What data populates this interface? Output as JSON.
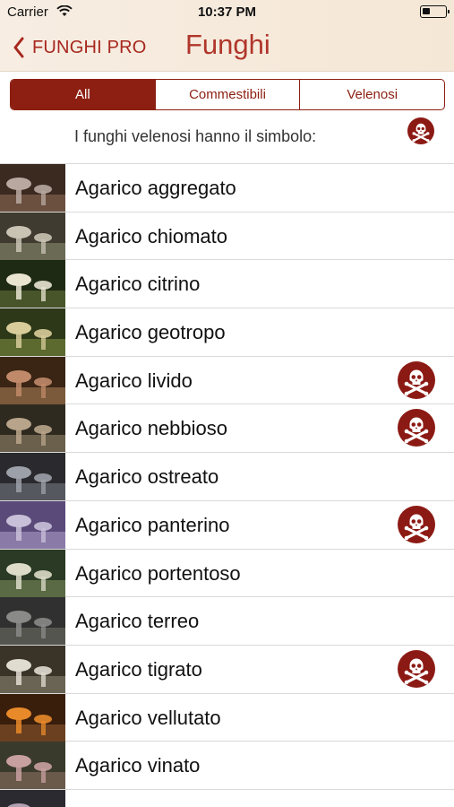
{
  "status": {
    "carrier": "Carrier",
    "time": "10:37 PM",
    "battery_level": 0.35
  },
  "nav": {
    "back_label": "FUNGHI PRO",
    "title": "Funghi"
  },
  "segments": [
    "All",
    "Commestibili",
    "Velenosi"
  ],
  "selected_segment": 0,
  "note": {
    "text": "I funghi velenosi hanno il simbolo:",
    "icon": "poison-skull-icon"
  },
  "colors": {
    "accent": "#8c1f12",
    "title": "#b0362b",
    "poison": "#8c1a14"
  },
  "items": [
    {
      "label": "Agarico aggregato",
      "poisonous": false,
      "thumb": "mushroom-photo-aggregato"
    },
    {
      "label": "Agarico chiomato",
      "poisonous": false,
      "thumb": "mushroom-photo-chiomato"
    },
    {
      "label": "Agarico citrino",
      "poisonous": false,
      "thumb": "mushroom-photo-citrino"
    },
    {
      "label": "Agarico geotropo",
      "poisonous": false,
      "thumb": "mushroom-photo-geotropo"
    },
    {
      "label": "Agarico livido",
      "poisonous": true,
      "thumb": "mushroom-photo-livido"
    },
    {
      "label": "Agarico nebbioso",
      "poisonous": true,
      "thumb": "mushroom-photo-nebbioso"
    },
    {
      "label": "Agarico ostreato",
      "poisonous": false,
      "thumb": "mushroom-photo-ostreato"
    },
    {
      "label": "Agarico panterino",
      "poisonous": true,
      "thumb": "mushroom-photo-panterino"
    },
    {
      "label": "Agarico portentoso",
      "poisonous": false,
      "thumb": "mushroom-photo-portentoso"
    },
    {
      "label": "Agarico terreo",
      "poisonous": false,
      "thumb": "mushroom-photo-terreo"
    },
    {
      "label": "Agarico tigrato",
      "poisonous": true,
      "thumb": "mushroom-photo-tigrato"
    },
    {
      "label": "Agarico vellutato",
      "poisonous": false,
      "thumb": "mushroom-photo-vellutato"
    },
    {
      "label": "Agarico vinato",
      "poisonous": false,
      "thumb": "mushroom-photo-vinato"
    },
    {
      "label": "",
      "poisonous": false,
      "thumb": "mushroom-photo-partial"
    }
  ]
}
